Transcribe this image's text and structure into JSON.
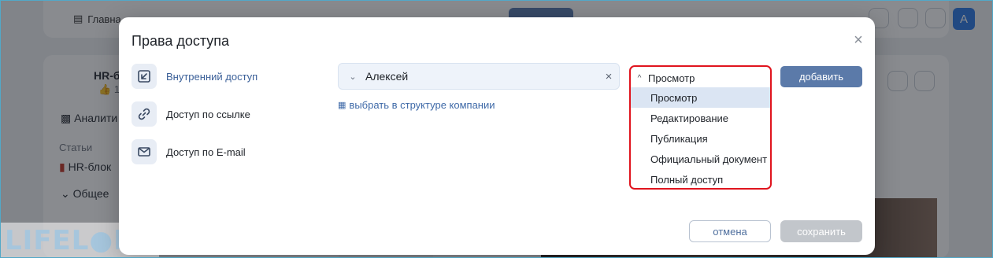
{
  "background": {
    "nav": [
      "Главна",
      "Аналити"
    ],
    "section_label": "Статьи",
    "folder": "HR-блок",
    "subfolder": "Общее",
    "group_title": "HR-б",
    "likes": "1",
    "avatar_letter": "A"
  },
  "watermark": "LIFEL●RU",
  "modal": {
    "title": "Права доступа",
    "tabs": [
      {
        "label": "Внутренний доступ",
        "icon": "arrow-down-left-icon",
        "active": true
      },
      {
        "label": "Доступ по ссылке",
        "icon": "link-icon",
        "active": false
      },
      {
        "label": "Доступ по E-mail",
        "icon": "mail-icon",
        "active": false
      }
    ],
    "user_field": {
      "value": "Алексей"
    },
    "structure_link": "выбрать в структуре компании",
    "permission": {
      "selected": "Просмотр",
      "options": [
        "Просмотр",
        "Редактирование",
        "Публикация",
        "Официальный документ",
        "Полный доступ"
      ]
    },
    "add_label": "добавить",
    "cancel_label": "отмена",
    "save_label": "сохранить"
  },
  "colors": {
    "accent": "#5b7aa9",
    "highlight_border": "#e0141e",
    "selected_option": "#dbe5f3"
  }
}
